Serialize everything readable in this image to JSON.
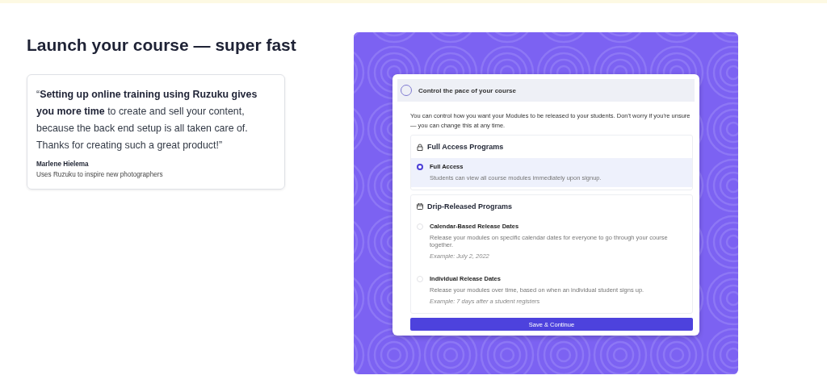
{
  "heading": "Launch your course — super fast",
  "testimonial": {
    "quote": "“**Setting up online training using Ruzuku gives you more time** to create and sell your content, because the back end setup is all taken care of. Thanks for creating such a great product!”",
    "author": "Marlene Hielema",
    "role": "Uses Ruzuku to inspire new photographers"
  },
  "dialog": {
    "title": "Control the pace of your course",
    "intro": "You can control how you want your Modules to be released to your students. Don't worry if you're unsure — you can change this at any time.",
    "groups": [
      {
        "kind": "lock",
        "title": "Full Access Programs",
        "options": [
          {
            "label": "Full Access",
            "description": "Students can view all course modules immediately upon signup.",
            "selected": true
          }
        ]
      },
      {
        "kind": "calendar",
        "title": "Drip-Released Programs",
        "options": [
          {
            "label": "Calendar-Based Release Dates",
            "description": "Release your modules on specific calendar dates for everyone to go through your course together.",
            "example": "Example: July 2, 2022",
            "selected": false
          },
          {
            "label": "Individual Release Dates",
            "description": "Release your modules over time, based on when an individual student signs up.",
            "example": "Example: 7 days after a student registers",
            "selected": false
          }
        ]
      }
    ],
    "button": "Save & Continue"
  }
}
